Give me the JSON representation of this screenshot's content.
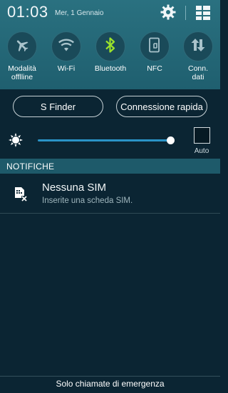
{
  "status_bar": {
    "time": "01:03",
    "date": "Mer, 1 Gennaio"
  },
  "quick_settings": {
    "toggles": [
      {
        "id": "airplane",
        "label": "Modalità\nofflline",
        "icon": "airplane-icon",
        "active": false
      },
      {
        "id": "wifi",
        "label": "Wi-Fi",
        "icon": "wifi-icon",
        "active": false
      },
      {
        "id": "bluetooth",
        "label": "Bluetooth",
        "icon": "bluetooth-icon",
        "active": true
      },
      {
        "id": "nfc",
        "label": "NFC",
        "icon": "nfc-icon",
        "active": false
      },
      {
        "id": "data",
        "label": "Conn.\ndati",
        "icon": "data-arrows-icon",
        "active": false
      }
    ],
    "active_color": "#9be22b",
    "inactive_color": "#a9c3cb",
    "sfinder_label": "S Finder",
    "quick_connect_label": "Connessione rapida"
  },
  "brightness": {
    "level": 0.98,
    "auto_label": "Auto",
    "auto_checked": false
  },
  "notifications": {
    "header": "NOTIFICHE",
    "items": [
      {
        "title": "Nessuna SIM",
        "subtitle": "Inserite una scheda SIM.",
        "icon": "no-sim-icon"
      }
    ]
  },
  "footer": {
    "text": "Solo chiamate di emergenza"
  },
  "colors": {
    "panel_top": "#246877",
    "background": "#0b2533",
    "accent_blue": "#2a93c7"
  }
}
